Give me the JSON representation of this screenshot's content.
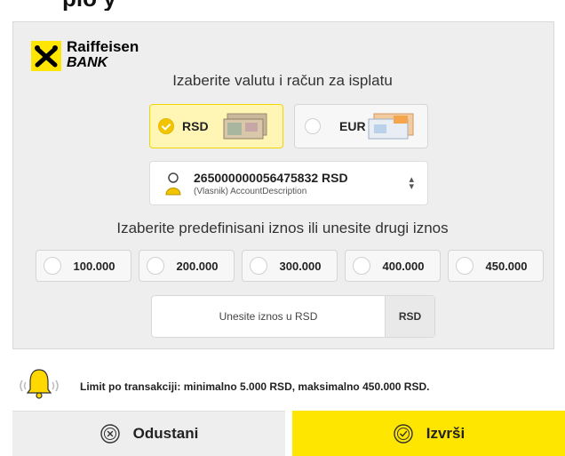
{
  "top_fragment": "plo y",
  "brand": {
    "line1": "Raiffeisen",
    "line2": "BANK"
  },
  "heading_currency": "Izaberite valutu i račun za isplatu",
  "currencies": [
    {
      "code": "RSD",
      "selected": true
    },
    {
      "code": "EUR",
      "selected": false
    }
  ],
  "account": {
    "number": "265000000056475832 RSD",
    "description": "(Vlasnik) AccountDescription",
    "icon": "user-icon"
  },
  "heading_amount": "Izaberite predefinisani iznos ili unesite drugi iznos",
  "amounts": [
    "100.000",
    "200.000",
    "300.000",
    "400.000",
    "450.000"
  ],
  "custom_amount": {
    "placeholder": "Unesite iznos u RSD",
    "value": "",
    "currency_suffix": "RSD"
  },
  "notice": "Limit po transakciji: minimalno 5.000 RSD, maksimalno 450.000 RSD.",
  "buttons": {
    "cancel": "Odustani",
    "confirm": "Izvrši"
  },
  "colors": {
    "accent": "#ffe600",
    "selected_bg": "#fff6b5",
    "panel": "#eeeeee"
  }
}
